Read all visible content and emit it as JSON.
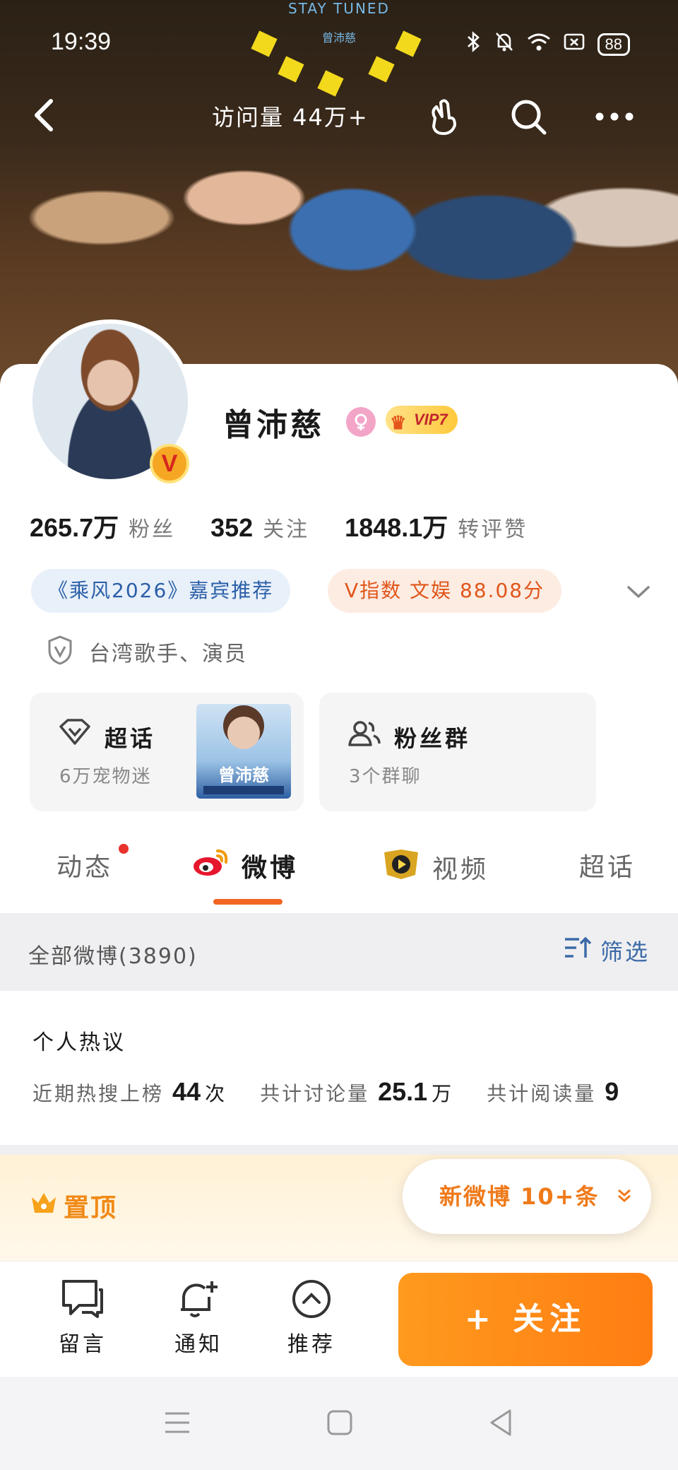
{
  "cover": {
    "sign_text": "STAY TUNED",
    "sign_name": "曾沛慈"
  },
  "status_bar": {
    "time": "19:39",
    "battery": "88"
  },
  "top_nav": {
    "visits": "访问量 44万+"
  },
  "profile": {
    "name": "曾沛慈",
    "vip": "VIP7",
    "stats": [
      {
        "num": "265.7万",
        "label": "粉丝"
      },
      {
        "num": "352",
        "label": "关注"
      },
      {
        "num": "1848.1万",
        "label": "转评赞"
      }
    ],
    "tags": {
      "recommend": "《乘风2026》嘉宾推荐",
      "vindex": "V指数 文娱 88.08分"
    },
    "identity": "台湾歌手、演员"
  },
  "features": {
    "super_topic": {
      "title": "超话",
      "sub": "6万宠物迷",
      "thumb_label": "曾沛慈"
    },
    "fan_group": {
      "title": "粉丝群",
      "sub": "3个群聊"
    }
  },
  "tabs": [
    {
      "label": "动态"
    },
    {
      "label": "微博"
    },
    {
      "label": "视频"
    },
    {
      "label": "超话"
    }
  ],
  "filter": {
    "title": "全部微博(3890)",
    "button": "筛选"
  },
  "hot": {
    "title": "个人热议",
    "items": [
      {
        "label": "近期热搜上榜",
        "value": "44",
        "unit": "次"
      },
      {
        "label": "共计讨论量",
        "value": "25.1",
        "unit": "万"
      },
      {
        "label": "共计阅读量",
        "value": "9",
        "unit": ""
      }
    ]
  },
  "pinned": {
    "label": "置顶",
    "new_posts": "新微博 10+条"
  },
  "actions": {
    "comment": "留言",
    "notify": "通知",
    "recommend": "推荐",
    "follow": "+ 关注"
  },
  "colors": {
    "accent_orange": "#ff8a1a",
    "link_blue": "#2b5fa8",
    "vip_red": "#c1272d"
  }
}
